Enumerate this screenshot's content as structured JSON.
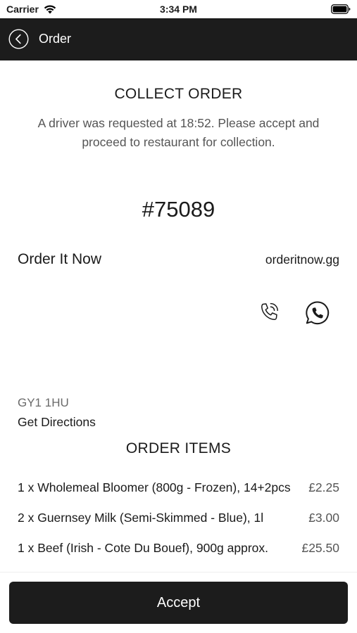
{
  "status_bar": {
    "carrier": "Carrier",
    "time": "3:34 PM",
    "icons": [
      "wifi-icon",
      "battery-icon"
    ]
  },
  "nav": {
    "title": "Order",
    "back_icon": "chevron-left-circle-icon",
    "background_color": "#1c1c1c"
  },
  "collect": {
    "heading": "COLLECT ORDER",
    "message": "A driver was requested at 18:52. Please accept and proceed to restaurant for collection."
  },
  "order": {
    "number": "#75089"
  },
  "restaurant": {
    "name": "Order It Now",
    "website": "orderitnow.gg",
    "contact_icons": [
      "phone-icon",
      "whatsapp-icon"
    ],
    "postcode": "GY1 1HU",
    "directions_label": "Get Directions"
  },
  "items_section": {
    "heading": "ORDER ITEMS",
    "items": [
      {
        "description": "1 x Wholemeal Bloomer (800g - Frozen), 14+2pcs",
        "price": "£2.25"
      },
      {
        "description": "2 x Guernsey Milk (Semi-Skimmed - Blue), 1l",
        "price": "£3.00"
      },
      {
        "description": "1 x Beef (Irish - Cote Du Bouef), 900g approx.",
        "price": "£25.50"
      }
    ]
  },
  "footer": {
    "accept_label": "Accept"
  }
}
